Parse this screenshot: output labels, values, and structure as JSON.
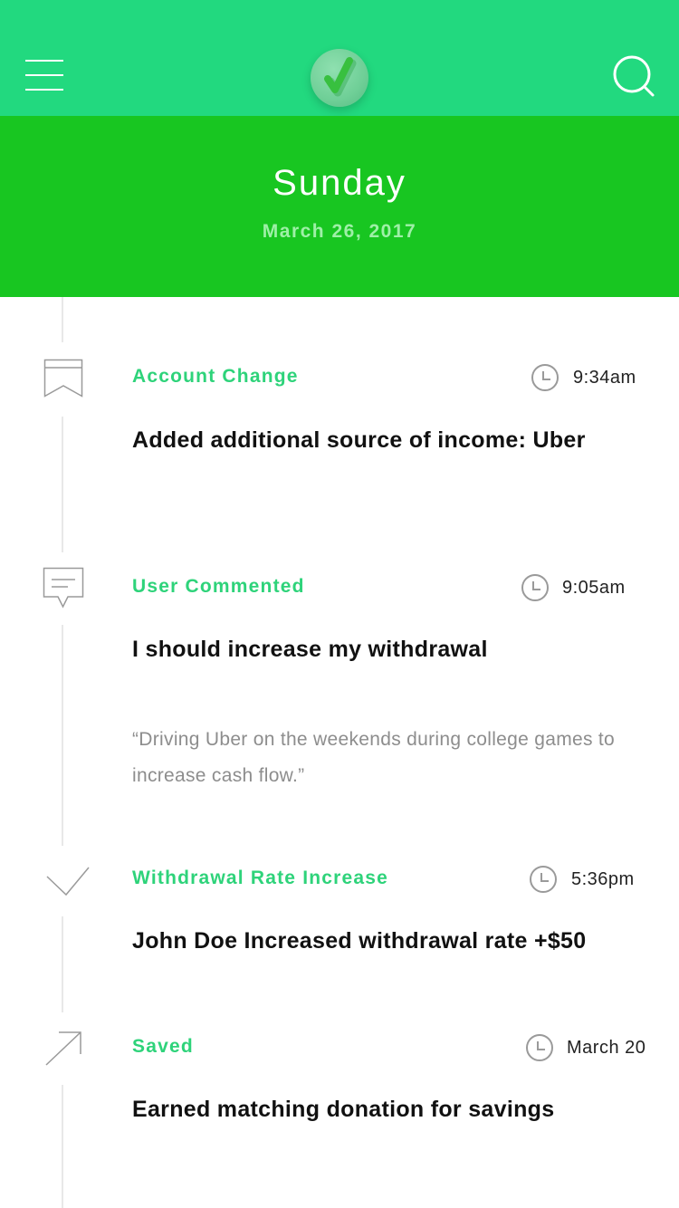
{
  "header": {
    "menu_icon": "hamburger-menu-icon",
    "logo_icon": "checkmark-logo-icon",
    "search_icon": "search-icon",
    "colors": {
      "nav": "#22d97f",
      "day_banner": "#18c621",
      "accent": "#2ed37a"
    }
  },
  "day": {
    "title": "Sunday",
    "date": "March 26, 2017"
  },
  "entries": [
    {
      "icon": "bookmark-icon",
      "type": "Account Change",
      "time": "9:34am",
      "title": "Added additional source of income: Uber"
    },
    {
      "icon": "comment-icon",
      "type": "User Commented",
      "time": "9:05am",
      "title": "I should increase my withdrawal",
      "quote": "“Driving Uber on the weekends during college games to increase cash flow.”"
    },
    {
      "icon": "check-icon",
      "type": "Withdrawal Rate Increase",
      "time": "5:36pm",
      "title": "John Doe Increased withdrawal rate +$50"
    },
    {
      "icon": "arrow-up-right-icon",
      "type": "Saved",
      "time": "March 20",
      "title": "Earned matching donation for savings"
    }
  ]
}
